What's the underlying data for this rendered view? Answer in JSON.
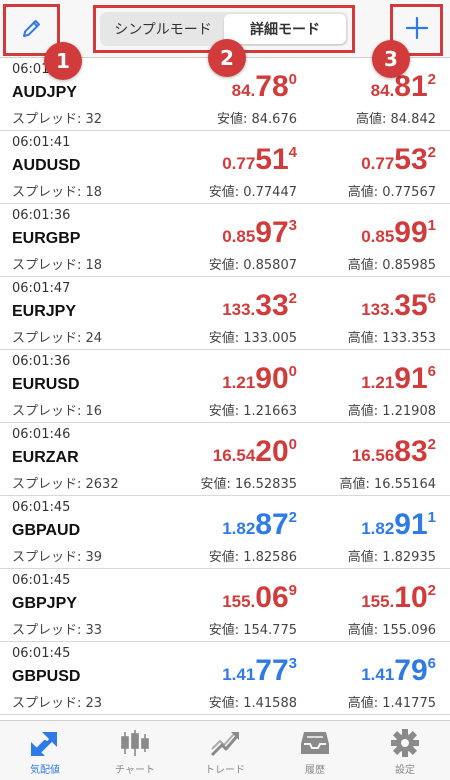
{
  "header": {
    "edit_icon": "pencil-icon",
    "add_icon": "plus-icon",
    "segments": [
      {
        "label": "シンプルモード",
        "active": false
      },
      {
        "label": "詳細モード",
        "active": true
      }
    ],
    "badges": [
      "1",
      "2",
      "3"
    ],
    "accent_color": "#d23b3b"
  },
  "quotes": [
    {
      "time": "06:01",
      "symbol": "AUDJPY",
      "spread": "スプレッド: 32",
      "bid": {
        "p1": "84.",
        "p2": "78",
        "p3": "0",
        "color": "red"
      },
      "ask": {
        "p1": "84.",
        "p2": "81",
        "p3": "2",
        "color": "red"
      },
      "low": "安値: 84.676",
      "high": "高値: 84.842"
    },
    {
      "time": "06:01:41",
      "symbol": "AUDUSD",
      "spread": "スプレッド: 18",
      "bid": {
        "p1": "0.77",
        "p2": "51",
        "p3": "4",
        "color": "red"
      },
      "ask": {
        "p1": "0.77",
        "p2": "53",
        "p3": "2",
        "color": "red"
      },
      "low": "安値: 0.77447",
      "high": "高値: 0.77567"
    },
    {
      "time": "06:01:36",
      "symbol": "EURGBP",
      "spread": "スプレッド: 18",
      "bid": {
        "p1": "0.85",
        "p2": "97",
        "p3": "3",
        "color": "red"
      },
      "ask": {
        "p1": "0.85",
        "p2": "99",
        "p3": "1",
        "color": "red"
      },
      "low": "安値: 0.85807",
      "high": "高値: 0.85985"
    },
    {
      "time": "06:01:47",
      "symbol": "EURJPY",
      "spread": "スプレッド: 24",
      "bid": {
        "p1": "133.",
        "p2": "33",
        "p3": "2",
        "color": "red"
      },
      "ask": {
        "p1": "133.",
        "p2": "35",
        "p3": "6",
        "color": "red"
      },
      "low": "安値: 133.005",
      "high": "高値: 133.353"
    },
    {
      "time": "06:01:36",
      "symbol": "EURUSD",
      "spread": "スプレッド: 16",
      "bid": {
        "p1": "1.21",
        "p2": "90",
        "p3": "0",
        "color": "red"
      },
      "ask": {
        "p1": "1.21",
        "p2": "91",
        "p3": "6",
        "color": "red"
      },
      "low": "安値: 1.21663",
      "high": "高値: 1.21908"
    },
    {
      "time": "06:01:46",
      "symbol": "EURZAR",
      "spread": "スプレッド: 2632",
      "bid": {
        "p1": "16.54",
        "p2": "20",
        "p3": "0",
        "color": "red"
      },
      "ask": {
        "p1": "16.56",
        "p2": "83",
        "p3": "2",
        "color": "red"
      },
      "low": "安値: 16.52835",
      "high": "高値: 16.55164"
    },
    {
      "time": "06:01:45",
      "symbol": "GBPAUD",
      "spread": "スプレッド: 39",
      "bid": {
        "p1": "1.82",
        "p2": "87",
        "p3": "2",
        "color": "blue"
      },
      "ask": {
        "p1": "1.82",
        "p2": "91",
        "p3": "1",
        "color": "blue"
      },
      "low": "安値: 1.82586",
      "high": "高値: 1.82935"
    },
    {
      "time": "06:01:45",
      "symbol": "GBPJPY",
      "spread": "スプレッド: 33",
      "bid": {
        "p1": "155.",
        "p2": "06",
        "p3": "9",
        "color": "red"
      },
      "ask": {
        "p1": "155.",
        "p2": "10",
        "p3": "2",
        "color": "red"
      },
      "low": "安値: 154.775",
      "high": "高値: 155.096"
    },
    {
      "time": "06:01:45",
      "symbol": "GBPUSD",
      "spread": "スプレッド: 23",
      "bid": {
        "p1": "1.41",
        "p2": "77",
        "p3": "3",
        "color": "blue"
      },
      "ask": {
        "p1": "1.41",
        "p2": "79",
        "p3": "6",
        "color": "blue"
      },
      "low": "安値: 1.41588",
      "high": "高値: 1.41775"
    }
  ],
  "tabbar": {
    "items": [
      {
        "label": "気配値",
        "icon": "quotes-arrows-icon",
        "active": true
      },
      {
        "label": "チャート",
        "icon": "candlestick-chart-icon",
        "active": false
      },
      {
        "label": "トレード",
        "icon": "trade-trend-icon",
        "active": false
      },
      {
        "label": "履歴",
        "icon": "history-inbox-icon",
        "active": false
      },
      {
        "label": "設定",
        "icon": "settings-gear-icon",
        "active": false
      }
    ]
  },
  "colors": {
    "red": "#d23b3b",
    "blue": "#2e7be8",
    "tab_inactive": "#8a8a8a"
  }
}
